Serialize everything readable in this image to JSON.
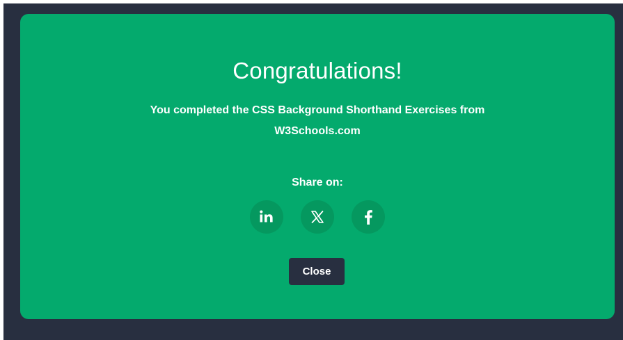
{
  "colors": {
    "overlay": "#282f40",
    "modal": "#04aa6d",
    "share_button": "#05985f",
    "close_button": "#282f40",
    "text": "#ffffff"
  },
  "modal": {
    "title": "Congratulations!",
    "message": "You completed the CSS Background Shorthand Exercises from W3Schools.com",
    "share_label": "Share on:",
    "share_buttons": [
      {
        "icon": "linkedin-icon"
      },
      {
        "icon": "x-icon"
      },
      {
        "icon": "facebook-icon"
      }
    ],
    "close_label": "Close"
  }
}
